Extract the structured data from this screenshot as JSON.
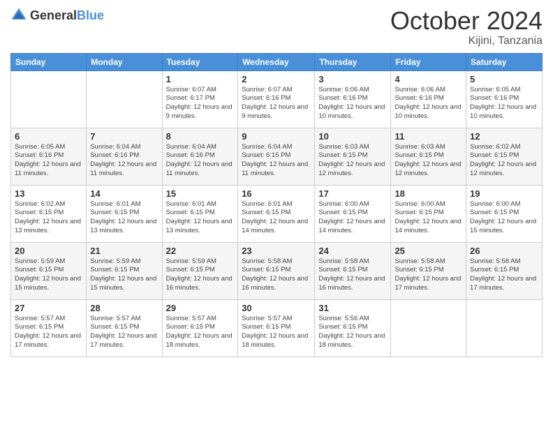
{
  "header": {
    "logo_general": "General",
    "logo_blue": "Blue",
    "month_title": "October 2024",
    "location": "Kijini, Tanzania"
  },
  "weekdays": [
    "Sunday",
    "Monday",
    "Tuesday",
    "Wednesday",
    "Thursday",
    "Friday",
    "Saturday"
  ],
  "weeks": [
    [
      {
        "day": "",
        "info": ""
      },
      {
        "day": "",
        "info": ""
      },
      {
        "day": "1",
        "info": "Sunrise: 6:07 AM\nSunset: 6:17 PM\nDaylight: 12 hours and 9 minutes."
      },
      {
        "day": "2",
        "info": "Sunrise: 6:07 AM\nSunset: 6:16 PM\nDaylight: 12 hours and 9 minutes."
      },
      {
        "day": "3",
        "info": "Sunrise: 6:06 AM\nSunset: 6:16 PM\nDaylight: 12 hours and 10 minutes."
      },
      {
        "day": "4",
        "info": "Sunrise: 6:06 AM\nSunset: 6:16 PM\nDaylight: 12 hours and 10 minutes."
      },
      {
        "day": "5",
        "info": "Sunrise: 6:05 AM\nSunset: 6:16 PM\nDaylight: 12 hours and 10 minutes."
      }
    ],
    [
      {
        "day": "6",
        "info": "Sunrise: 6:05 AM\nSunset: 6:16 PM\nDaylight: 12 hours and 11 minutes."
      },
      {
        "day": "7",
        "info": "Sunrise: 6:04 AM\nSunset: 6:16 PM\nDaylight: 12 hours and 11 minutes."
      },
      {
        "day": "8",
        "info": "Sunrise: 6:04 AM\nSunset: 6:16 PM\nDaylight: 12 hours and 11 minutes."
      },
      {
        "day": "9",
        "info": "Sunrise: 6:04 AM\nSunset: 6:15 PM\nDaylight: 12 hours and 11 minutes."
      },
      {
        "day": "10",
        "info": "Sunrise: 6:03 AM\nSunset: 6:15 PM\nDaylight: 12 hours and 12 minutes."
      },
      {
        "day": "11",
        "info": "Sunrise: 6:03 AM\nSunset: 6:15 PM\nDaylight: 12 hours and 12 minutes."
      },
      {
        "day": "12",
        "info": "Sunrise: 6:02 AM\nSunset: 6:15 PM\nDaylight: 12 hours and 12 minutes."
      }
    ],
    [
      {
        "day": "13",
        "info": "Sunrise: 6:02 AM\nSunset: 6:15 PM\nDaylight: 12 hours and 13 minutes."
      },
      {
        "day": "14",
        "info": "Sunrise: 6:01 AM\nSunset: 6:15 PM\nDaylight: 12 hours and 13 minutes."
      },
      {
        "day": "15",
        "info": "Sunrise: 6:01 AM\nSunset: 6:15 PM\nDaylight: 12 hours and 13 minutes."
      },
      {
        "day": "16",
        "info": "Sunrise: 6:01 AM\nSunset: 6:15 PM\nDaylight: 12 hours and 14 minutes."
      },
      {
        "day": "17",
        "info": "Sunrise: 6:00 AM\nSunset: 6:15 PM\nDaylight: 12 hours and 14 minutes."
      },
      {
        "day": "18",
        "info": "Sunrise: 6:00 AM\nSunset: 6:15 PM\nDaylight: 12 hours and 14 minutes."
      },
      {
        "day": "19",
        "info": "Sunrise: 6:00 AM\nSunset: 6:15 PM\nDaylight: 12 hours and 15 minutes."
      }
    ],
    [
      {
        "day": "20",
        "info": "Sunrise: 5:59 AM\nSunset: 6:15 PM\nDaylight: 12 hours and 15 minutes."
      },
      {
        "day": "21",
        "info": "Sunrise: 5:59 AM\nSunset: 6:15 PM\nDaylight: 12 hours and 15 minutes."
      },
      {
        "day": "22",
        "info": "Sunrise: 5:59 AM\nSunset: 6:15 PM\nDaylight: 12 hours and 16 minutes."
      },
      {
        "day": "23",
        "info": "Sunrise: 5:58 AM\nSunset: 6:15 PM\nDaylight: 12 hours and 16 minutes."
      },
      {
        "day": "24",
        "info": "Sunrise: 5:58 AM\nSunset: 6:15 PM\nDaylight: 12 hours and 16 minutes."
      },
      {
        "day": "25",
        "info": "Sunrise: 5:58 AM\nSunset: 6:15 PM\nDaylight: 12 hours and 17 minutes."
      },
      {
        "day": "26",
        "info": "Sunrise: 5:58 AM\nSunset: 6:15 PM\nDaylight: 12 hours and 17 minutes."
      }
    ],
    [
      {
        "day": "27",
        "info": "Sunrise: 5:57 AM\nSunset: 6:15 PM\nDaylight: 12 hours and 17 minutes."
      },
      {
        "day": "28",
        "info": "Sunrise: 5:57 AM\nSunset: 6:15 PM\nDaylight: 12 hours and 17 minutes."
      },
      {
        "day": "29",
        "info": "Sunrise: 5:57 AM\nSunset: 6:15 PM\nDaylight: 12 hours and 18 minutes."
      },
      {
        "day": "30",
        "info": "Sunrise: 5:57 AM\nSunset: 6:15 PM\nDaylight: 12 hours and 18 minutes."
      },
      {
        "day": "31",
        "info": "Sunrise: 5:56 AM\nSunset: 6:15 PM\nDaylight: 12 hours and 18 minutes."
      },
      {
        "day": "",
        "info": ""
      },
      {
        "day": "",
        "info": ""
      }
    ]
  ]
}
